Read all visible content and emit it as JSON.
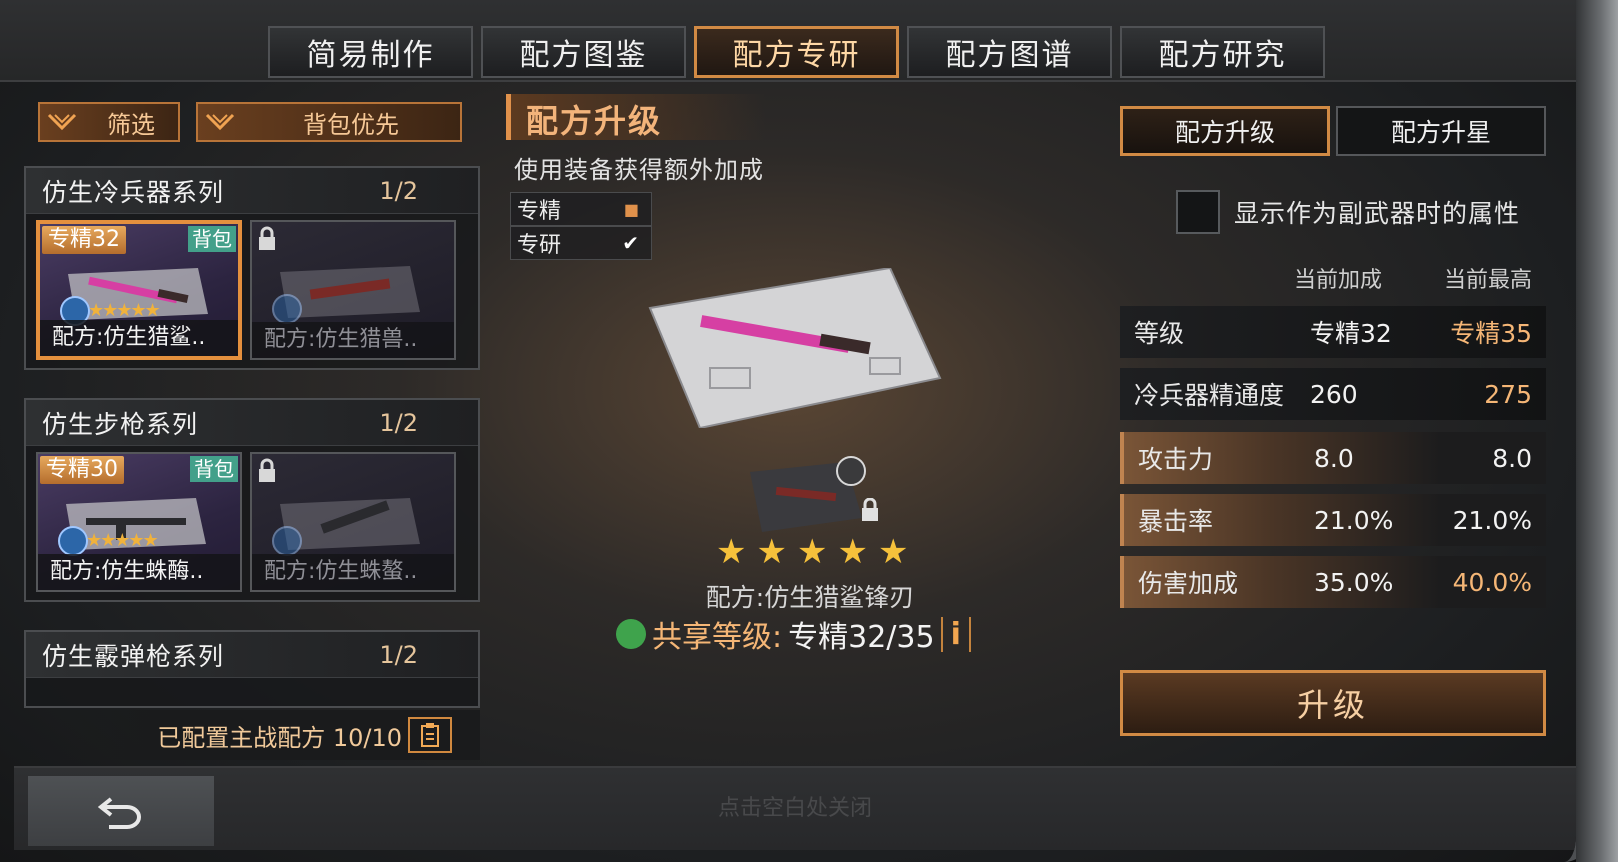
{
  "top_tabs": [
    "简易制作",
    "配方图鉴",
    "配方专研",
    "配方图谱",
    "配方研究"
  ],
  "active_tab_index": 2,
  "left": {
    "filter_label": "筛选",
    "backpack_priority_label": "背包优先",
    "series": [
      {
        "name": "仿生冷兵器系列",
        "count": "1/2",
        "cards": [
          {
            "rank": "专精32",
            "bag": "背包",
            "name": "配方:仿生猎鲨..",
            "stars": "★★★★★",
            "locked": false,
            "selected": true
          },
          {
            "name": "配方:仿生猎兽..",
            "locked": true
          }
        ]
      },
      {
        "name": "仿生步枪系列",
        "count": "1/2",
        "cards": [
          {
            "rank": "专精30",
            "bag": "背包",
            "name": "配方:仿生蛛酶..",
            "stars": "★★★★★",
            "locked": false,
            "selected": false
          },
          {
            "name": "配方:仿生蛛螯..",
            "locked": true
          }
        ]
      },
      {
        "name": "仿生霰弹枪系列",
        "count": "1/2"
      }
    ],
    "equipped_text": "已配置主战配方 10/10"
  },
  "middle": {
    "title": "配方升级",
    "subtitle": "使用装备获得额外加成",
    "options": [
      "专精",
      "专研"
    ],
    "stars": "★★★★★",
    "item_name": "配方:仿生猎鲨锋刃",
    "share_level_label": "共享等级:",
    "share_level_value": "专精32/35",
    "info_symbol": "i"
  },
  "right": {
    "sub_tabs": [
      "配方升级",
      "配方升星"
    ],
    "secondary_attr_label": "显示作为副武器时的属性",
    "col_current": "当前加成",
    "col_max": "当前最高",
    "stats": [
      {
        "key": "等级",
        "current": "专精32",
        "max": "专精35",
        "up": true
      },
      {
        "key": "冷兵器精通度",
        "current": "260",
        "max": "275",
        "up": true
      },
      {
        "key": "攻击力",
        "current": "8.0",
        "max": "8.0",
        "up": false
      },
      {
        "key": "暴击率",
        "current": "21.0%",
        "max": "21.0%",
        "up": false
      },
      {
        "key": "伤害加成",
        "current": "35.0%",
        "max": "40.0%",
        "up": true
      }
    ],
    "upgrade_label": "升级"
  },
  "bottom": {
    "close_hint": "点击空白处关闭"
  },
  "colors": {
    "accent": "#d18a44",
    "highlight_text": "#f5b676",
    "star": "#f6c13b",
    "bag_badge": "#43a08a"
  }
}
